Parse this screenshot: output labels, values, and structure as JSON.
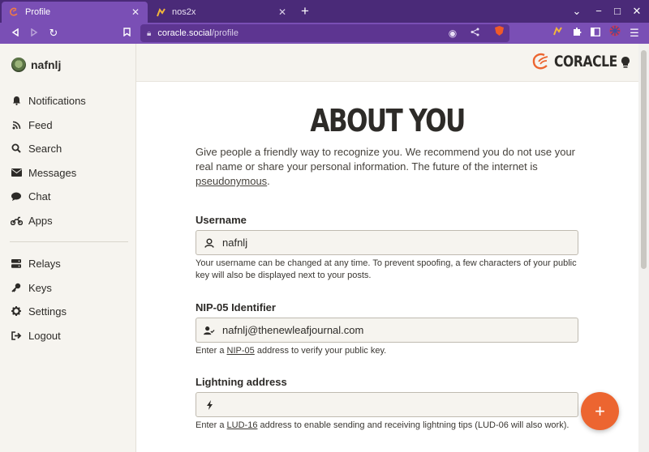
{
  "browser": {
    "tabs": [
      {
        "title": "Profile",
        "active": true
      },
      {
        "title": "nos2x",
        "active": false
      }
    ],
    "url": {
      "host": "coracle.social",
      "path": "/profile"
    },
    "accent": "#7a4fb5"
  },
  "sidebar": {
    "profile_name": "nafnlj",
    "items_top": [
      {
        "label": "Notifications",
        "icon": "bell-icon"
      },
      {
        "label": "Feed",
        "icon": "rss-icon"
      },
      {
        "label": "Search",
        "icon": "search-icon"
      },
      {
        "label": "Messages",
        "icon": "envelope-icon"
      },
      {
        "label": "Chat",
        "icon": "chat-bubble-icon"
      },
      {
        "label": "Apps",
        "icon": "motorcycle-icon"
      }
    ],
    "items_bottom": [
      {
        "label": "Relays",
        "icon": "server-icon"
      },
      {
        "label": "Keys",
        "icon": "key-icon"
      },
      {
        "label": "Settings",
        "icon": "gear-icon"
      },
      {
        "label": "Logout",
        "icon": "logout-icon"
      }
    ]
  },
  "header": {
    "brand": "CORACLE",
    "brand_color": "#ec6530"
  },
  "main": {
    "title": "ABOUT YOU",
    "intro_text": "Give people a friendly way to recognize you. We recommend you do not use your real name or share your personal information. The future of the internet is ",
    "intro_link": "pseudonymous",
    "intro_end": ".",
    "username": {
      "label": "Username",
      "value": "nafnlj",
      "help": "Your username can be changed at any time. To prevent spoofing, a few characters of your public key will also be displayed next to your posts."
    },
    "nip05": {
      "label": "NIP-05 Identifier",
      "value": "nafnlj@thenewleafjournal.com",
      "help_pre": "Enter a ",
      "help_link": "NIP-05",
      "help_post": " address to verify your public key."
    },
    "lightning": {
      "label": "Lightning address",
      "value": "",
      "help_pre": "Enter a ",
      "help_link": "LUD-16",
      "help_post": " address to enable sending and receiving lightning tips (LUD-06 will also work)."
    },
    "fab_label": "+"
  }
}
